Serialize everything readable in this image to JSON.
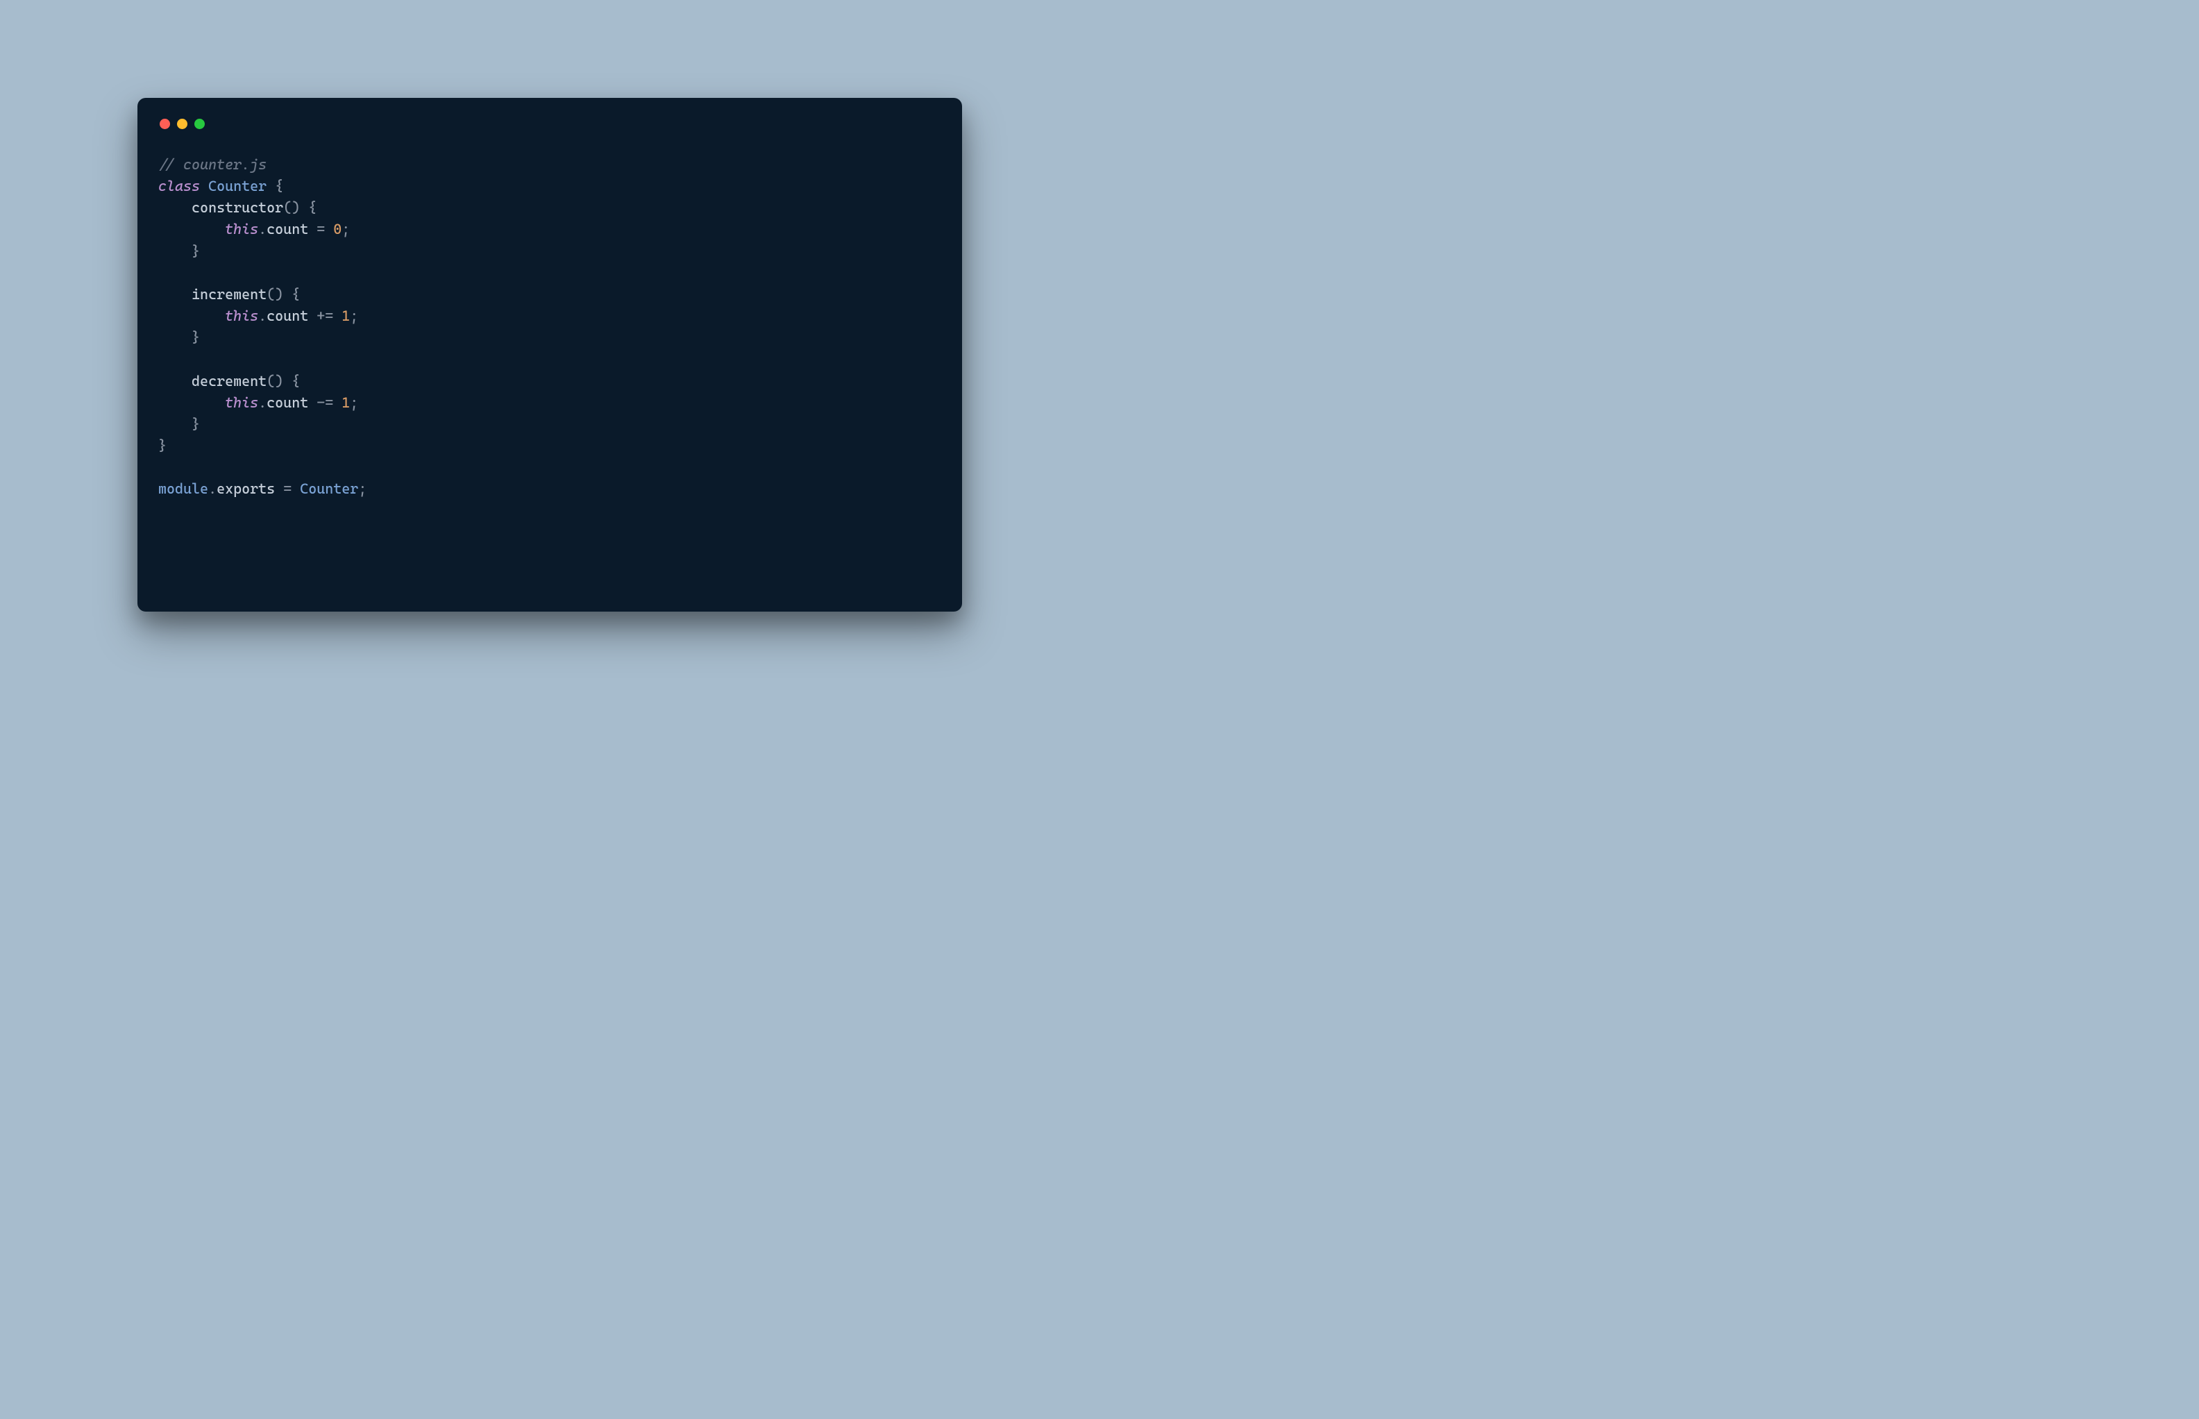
{
  "traffic_lights": {
    "red": "#ff5f56",
    "yellow": "#ffbd2e",
    "green": "#27c93f"
  },
  "code": {
    "comment": "// counter.js",
    "kw_class": "class",
    "class_name": "Counter",
    "brace_open": "{",
    "brace_close": "}",
    "fn_constructor": "constructor",
    "parens": "()",
    "kw_this": "this",
    "dot": ".",
    "prop_count": "count",
    "op_assign": "=",
    "num_zero": "0",
    "semicolon": ";",
    "fn_increment": "increment",
    "op_plus_assign": "+=",
    "num_one": "1",
    "fn_decrement": "decrement",
    "op_minus_assign": "-=",
    "ident_module": "module",
    "prop_exports": "exports",
    "ident_counter": "Counter"
  }
}
